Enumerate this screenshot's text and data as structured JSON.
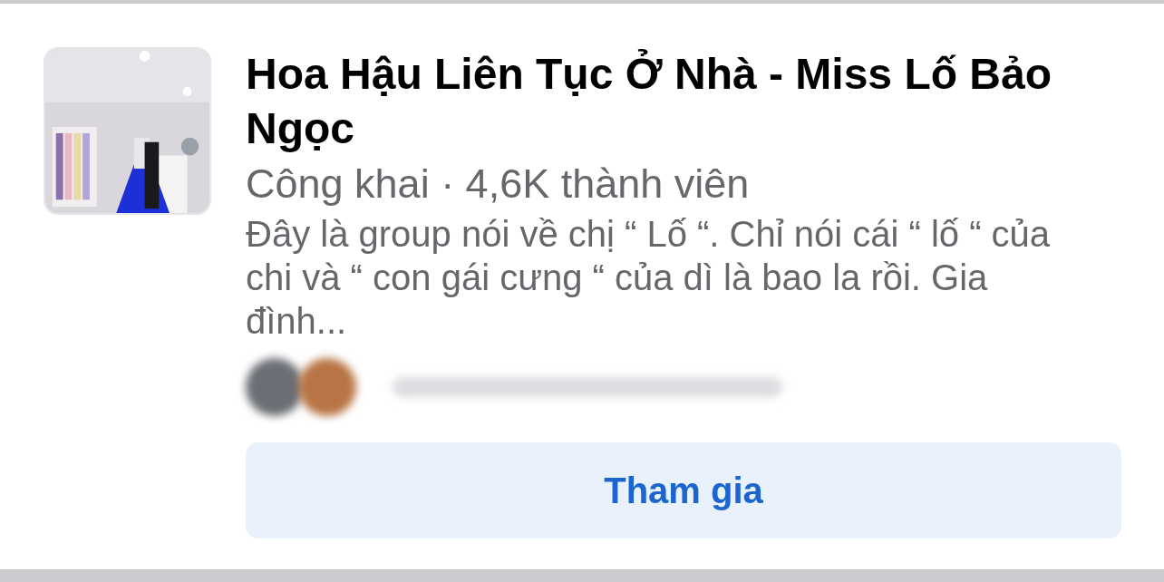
{
  "group": {
    "name": "Hoa Hậu Liên Tục Ở Nhà - Miss Lố Bảo Ngọc",
    "meta": "Công khai · 4,6K thành viên",
    "description": "Đây là group nói về chị “ Lố “. Chỉ nói cái “ lố “ của chi và “ con gái cưng “ của dì là bao la rồi. Gia đình...",
    "members_preview": {
      "avatars": [
        {
          "color": "#6b6e74"
        },
        {
          "color": "#b87444"
        }
      ]
    },
    "join_button": "Tham gia"
  }
}
